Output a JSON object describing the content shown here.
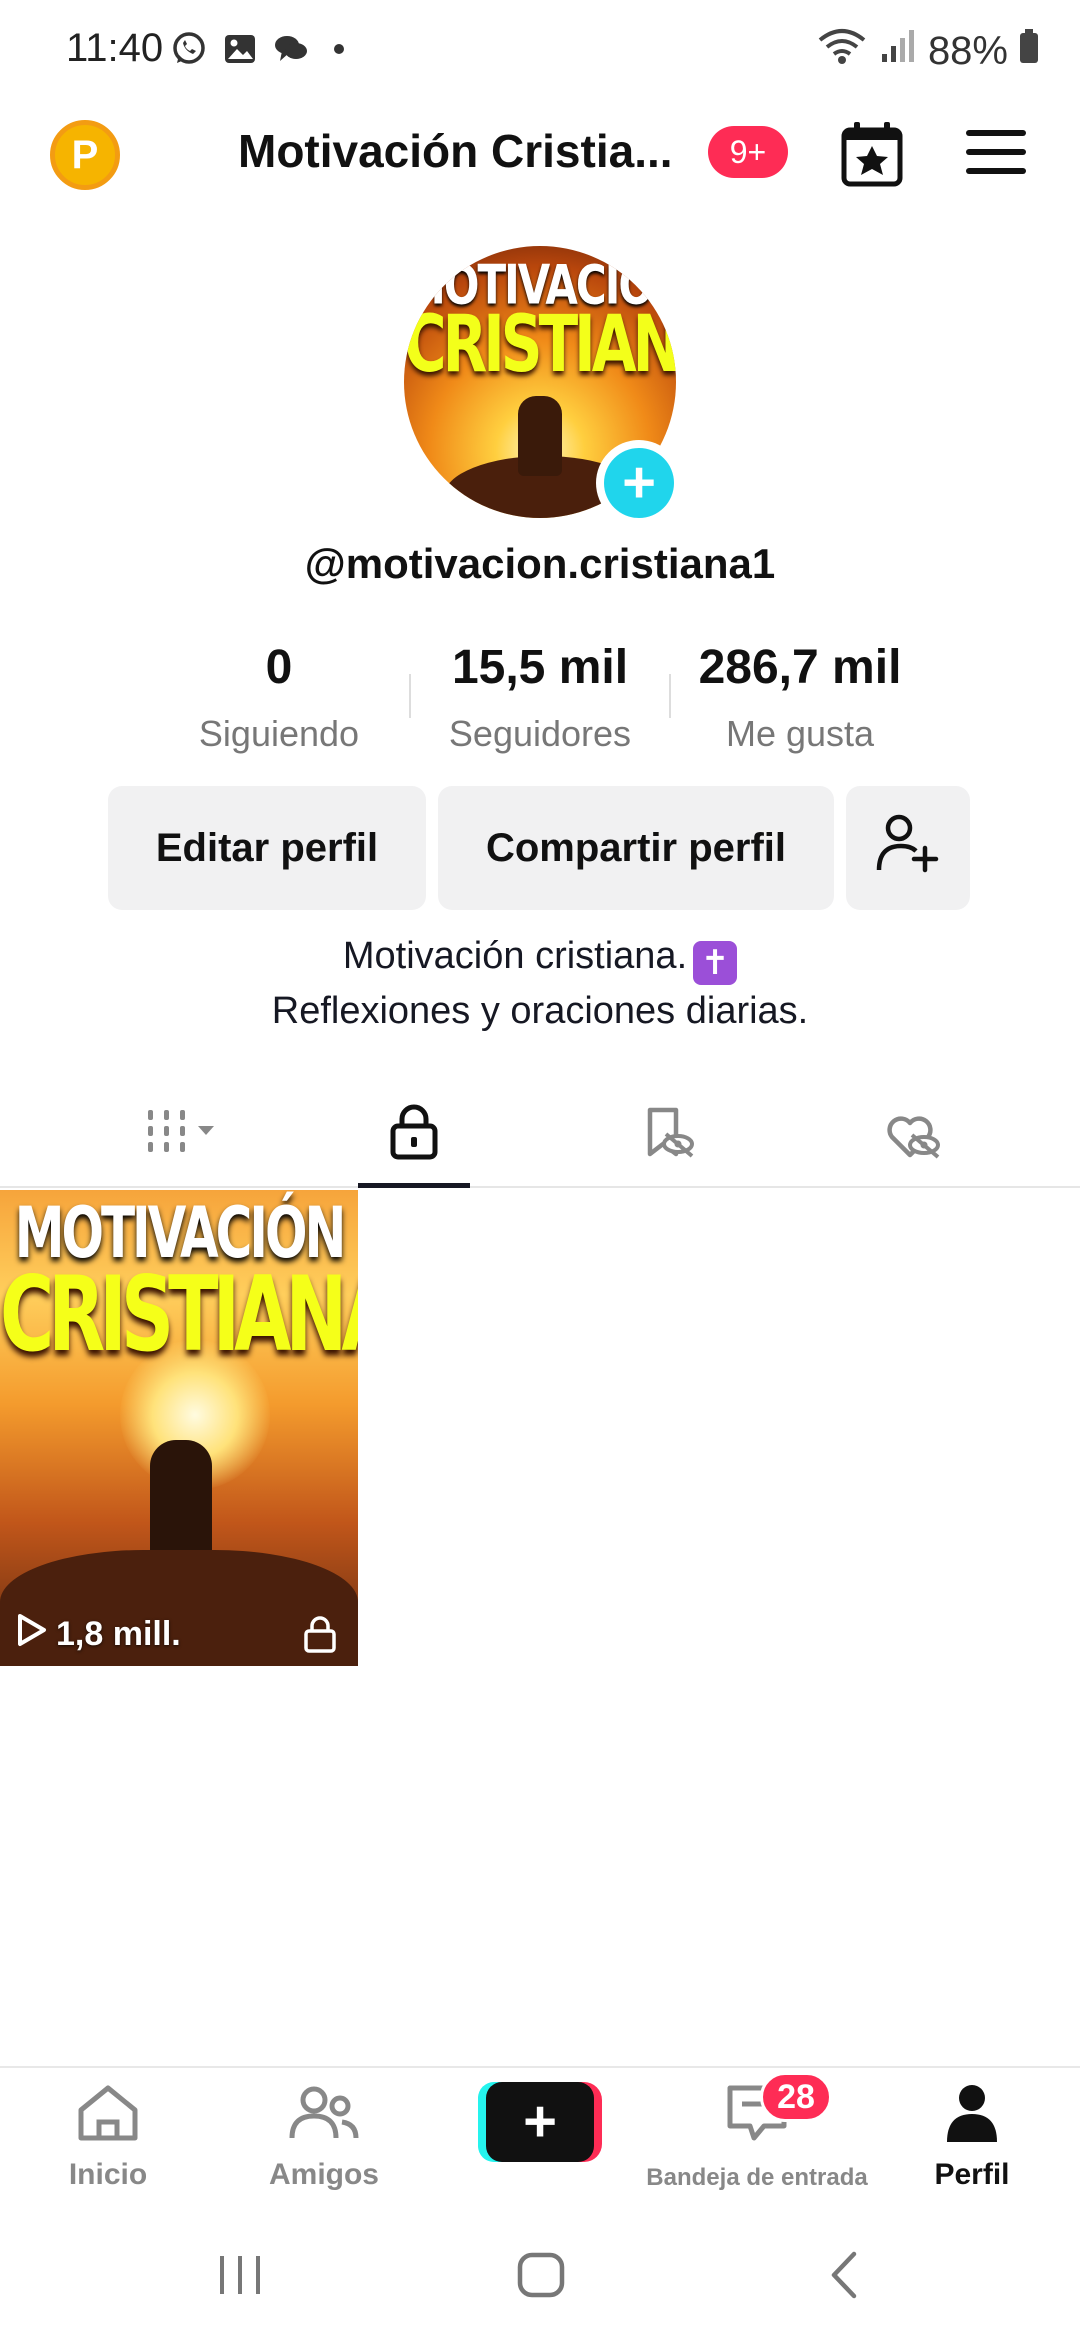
{
  "status_bar": {
    "time": "11:40",
    "battery": "88%"
  },
  "header": {
    "title": "Motivación Cristia...",
    "notification_badge": "9+"
  },
  "profile": {
    "handle": "@motivacion.cristiana1",
    "avatar_text_line1": "MOTIVACIÓN",
    "avatar_text_line2": "CRISTIANA"
  },
  "stats": {
    "following_value": "0",
    "following_label": "Siguiendo",
    "followers_value": "15,5 mil",
    "followers_label": "Seguidores",
    "likes_value": "286,7 mil",
    "likes_label": "Me gusta"
  },
  "actions": {
    "edit_label": "Editar perfil",
    "share_label": "Compartir perfil"
  },
  "bio": {
    "line1": "Motivación cristiana.",
    "line2": "Reflexiones y oraciones diarias.",
    "emoji": "✝"
  },
  "videos": [
    {
      "title_line1": "MOTIVACIÓN",
      "title_line2": "CRISTIANA",
      "views": "1,8 mill."
    }
  ],
  "bottom_nav": {
    "home_label": "Inicio",
    "friends_label": "Amigos",
    "inbox_label": "Bandeja de entrada",
    "inbox_badge": "28",
    "profile_label": "Perfil"
  },
  "colors": {
    "accent_red": "#fe2c55",
    "accent_cyan": "#20d5ec",
    "button_grey": "#f1f1f2"
  }
}
